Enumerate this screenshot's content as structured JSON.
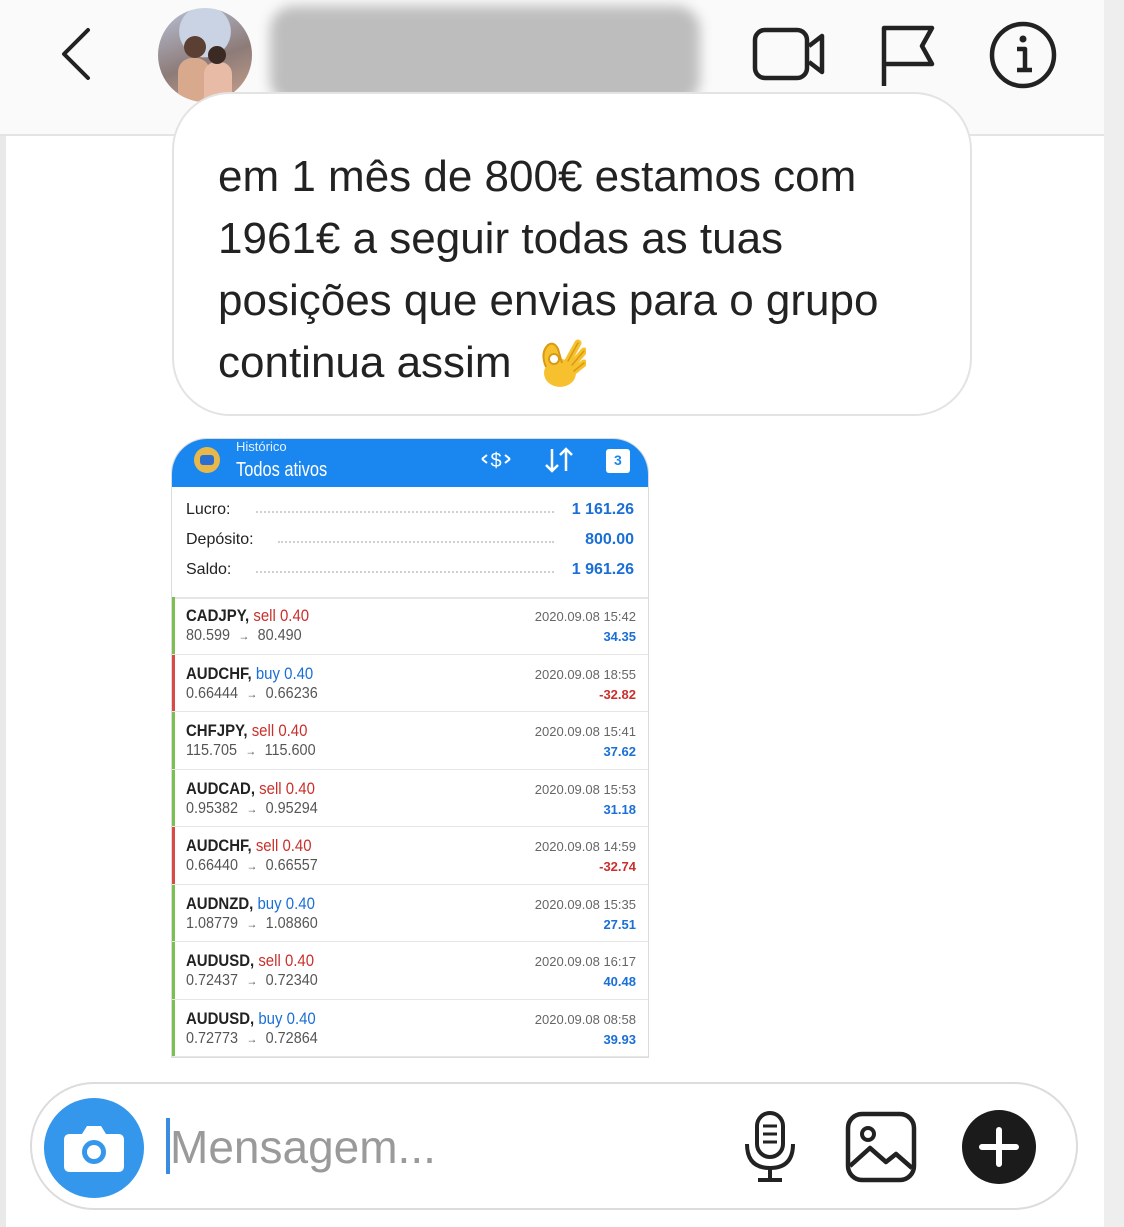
{
  "header": {
    "back_icon": "chevron-left-icon",
    "actions": [
      "video-call-icon",
      "flag-icon",
      "info-icon"
    ]
  },
  "message": {
    "text": "em 1 mês de 800€ estamos com 1961€ a seguir todas as tuas posições que envias para o grupo continua assim",
    "emoji": "ok-hand-emoji"
  },
  "screenshot": {
    "subtitle": "Histórico",
    "title": "Todos ativos",
    "calendar_badge": "3",
    "summary": [
      {
        "label": "Lucro:",
        "value": "1 161.26"
      },
      {
        "label": "Depósito:",
        "value": "800.00"
      },
      {
        "label": "Saldo:",
        "value": "1 961.26"
      }
    ],
    "trades": [
      {
        "symbol": "CADJPY,",
        "side": "sell",
        "lot": "0.40",
        "open": "80.599",
        "close": "80.490",
        "date": "2020.09.08 15:42",
        "profit": "34.35",
        "profit_color": "#1a6fd6",
        "side_color": "#c9302c",
        "bar_color": "#7bbf52"
      },
      {
        "symbol": "AUDCHF,",
        "side": "buy",
        "lot": "0.40",
        "open": "0.66444",
        "close": "0.66236",
        "date": "2020.09.08 18:55",
        "profit": "-32.82",
        "profit_color": "#c9302c",
        "side_color": "#1a6fd6",
        "bar_color": "#d94a45"
      },
      {
        "symbol": "CHFJPY,",
        "side": "sell",
        "lot": "0.40",
        "open": "115.705",
        "close": "115.600",
        "date": "2020.09.08 15:41",
        "profit": "37.62",
        "profit_color": "#1a6fd6",
        "side_color": "#c9302c",
        "bar_color": "#7bbf52"
      },
      {
        "symbol": "AUDCAD,",
        "side": "sell",
        "lot": "0.40",
        "open": "0.95382",
        "close": "0.95294",
        "date": "2020.09.08 15:53",
        "profit": "31.18",
        "profit_color": "#1a6fd6",
        "side_color": "#c9302c",
        "bar_color": "#7bbf52"
      },
      {
        "symbol": "AUDCHF,",
        "side": "sell",
        "lot": "0.40",
        "open": "0.66440",
        "close": "0.66557",
        "date": "2020.09.08 14:59",
        "profit": "-32.74",
        "profit_color": "#c9302c",
        "side_color": "#c9302c",
        "bar_color": "#d94a45"
      },
      {
        "symbol": "AUDNZD,",
        "side": "buy",
        "lot": "0.40",
        "open": "1.08779",
        "close": "1.08860",
        "date": "2020.09.08 15:35",
        "profit": "27.51",
        "profit_color": "#1a6fd6",
        "side_color": "#1a6fd6",
        "bar_color": "#7bbf52"
      },
      {
        "symbol": "AUDUSD,",
        "side": "sell",
        "lot": "0.40",
        "open": "0.72437",
        "close": "0.72340",
        "date": "2020.09.08 16:17",
        "profit": "40.48",
        "profit_color": "#1a6fd6",
        "side_color": "#c9302c",
        "bar_color": "#7bbf52"
      },
      {
        "symbol": "AUDUSD,",
        "side": "buy",
        "lot": "0.40",
        "open": "0.72773",
        "close": "0.72864",
        "date": "2020.09.08 08:58",
        "profit": "39.93",
        "profit_color": "#1a6fd6",
        "side_color": "#1a6fd6",
        "bar_color": "#7bbf52"
      }
    ]
  },
  "composer": {
    "placeholder": "Mensagem...",
    "icons": [
      "camera-icon",
      "microphone-icon",
      "gallery-icon",
      "plus-icon"
    ]
  }
}
